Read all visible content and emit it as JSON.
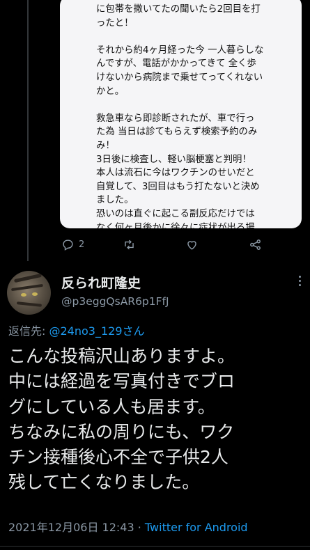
{
  "quoted_card": {
    "lines": [
      "に包帯を撒いてたの聞いたら2回目を打",
      "ったと！",
      "",
      "それから約4ヶ月経った今 一人暮らしな",
      "んですが、電話がかかってきて 全く歩",
      "けないから病院まで乗せてってくれない",
      "かと。",
      "",
      "救急車なら即診断されたが、車で行っ",
      "た為 当日は診てもらえず検索予約のみ",
      "み！",
      "3日後に検査し、軽い脳梗塞と判明！",
      "本人は流石に今はワクチンのせいだと",
      "自覚して、3回目はもう打たないと決め",
      "ました。",
      "恐いのは直ぐに起こる副反応だけでは",
      "なく何ヶ月後かに徐々に症状が出る場"
    ]
  },
  "actions": {
    "reply_count": "2",
    "icons": [
      "reply-icon",
      "retweet-icon",
      "like-icon",
      "share-icon"
    ]
  },
  "author": {
    "display_name": "反られ町隆史",
    "handle": "@p3eggQsAR6p1FfJ"
  },
  "reply": {
    "prefix": "返信先: ",
    "target": "@24no3_129さん"
  },
  "tweet": {
    "lines": [
      "こんな投稿沢山ありますよ。",
      "中には経過を写真付きでブロ",
      "グにしている人も居ます。",
      "ちなみに私の周りにも、ワク",
      "チン接種後心不全で子供2人",
      "残して亡くなりました。"
    ]
  },
  "meta": {
    "timestamp": "2021年12月06日 12:43",
    "separator": " · ",
    "source": "Twitter for Android"
  },
  "colors": {
    "background": "#000000",
    "text": "#e7e9ea",
    "secondary": "#8b98a5",
    "link": "#1d9bf0",
    "card": "#f5f5f7"
  }
}
